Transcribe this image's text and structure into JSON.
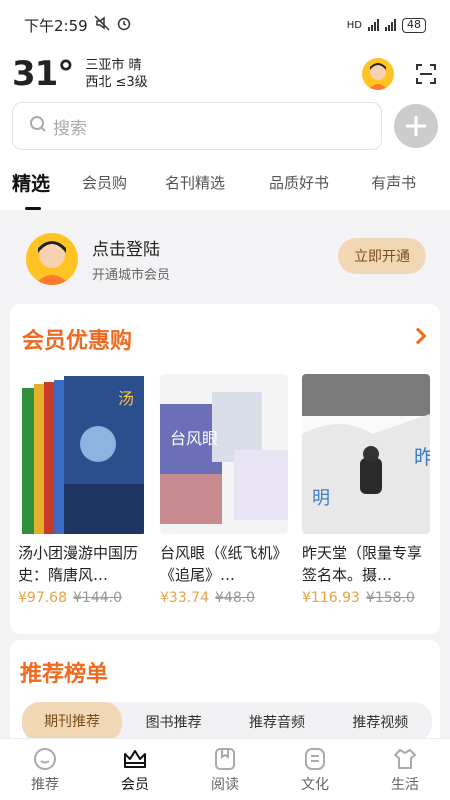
{
  "status": {
    "time": "下午2:59",
    "battery": "48"
  },
  "weather": {
    "temp": "31°",
    "city_condition": "三亚市 晴",
    "wind": "西北 ≤3级"
  },
  "search": {
    "placeholder": "搜索"
  },
  "tabs": [
    {
      "label": "精选"
    },
    {
      "label": "会员购"
    },
    {
      "label": "名刊精选"
    },
    {
      "label": "品质好书"
    },
    {
      "label": "有声书"
    }
  ],
  "login": {
    "title": "点击登陆",
    "subtitle": "开通城市会员",
    "button": "立即开通"
  },
  "member_section": {
    "title": "会员优惠购",
    "books": [
      {
        "title": "汤小团漫游中国历史：隋唐风…",
        "price": "¥97.68",
        "old_price": "¥144.0"
      },
      {
        "title": "台风眼（《纸飞机》《追尾》…",
        "price": "¥33.74",
        "old_price": "¥48.0"
      },
      {
        "title": "昨天堂（限量专享签名本。摄…",
        "price": "¥116.93",
        "old_price": "¥158.0"
      }
    ]
  },
  "rank_section": {
    "title": "推荐榜单",
    "tabs": [
      {
        "label": "期刊推荐"
      },
      {
        "label": "图书推荐"
      },
      {
        "label": "推荐音频"
      },
      {
        "label": "推荐视频"
      }
    ]
  },
  "bottom_nav": [
    {
      "label": "推荐",
      "icon": "smile-icon"
    },
    {
      "label": "会员",
      "icon": "crown-icon"
    },
    {
      "label": "阅读",
      "icon": "book-icon"
    },
    {
      "label": "文化",
      "icon": "document-icon"
    },
    {
      "label": "生活",
      "icon": "cloth-icon"
    }
  ],
  "colors": {
    "accent": "#f06a1f",
    "gold": "#f1d7b6",
    "price": "#e8a245"
  }
}
